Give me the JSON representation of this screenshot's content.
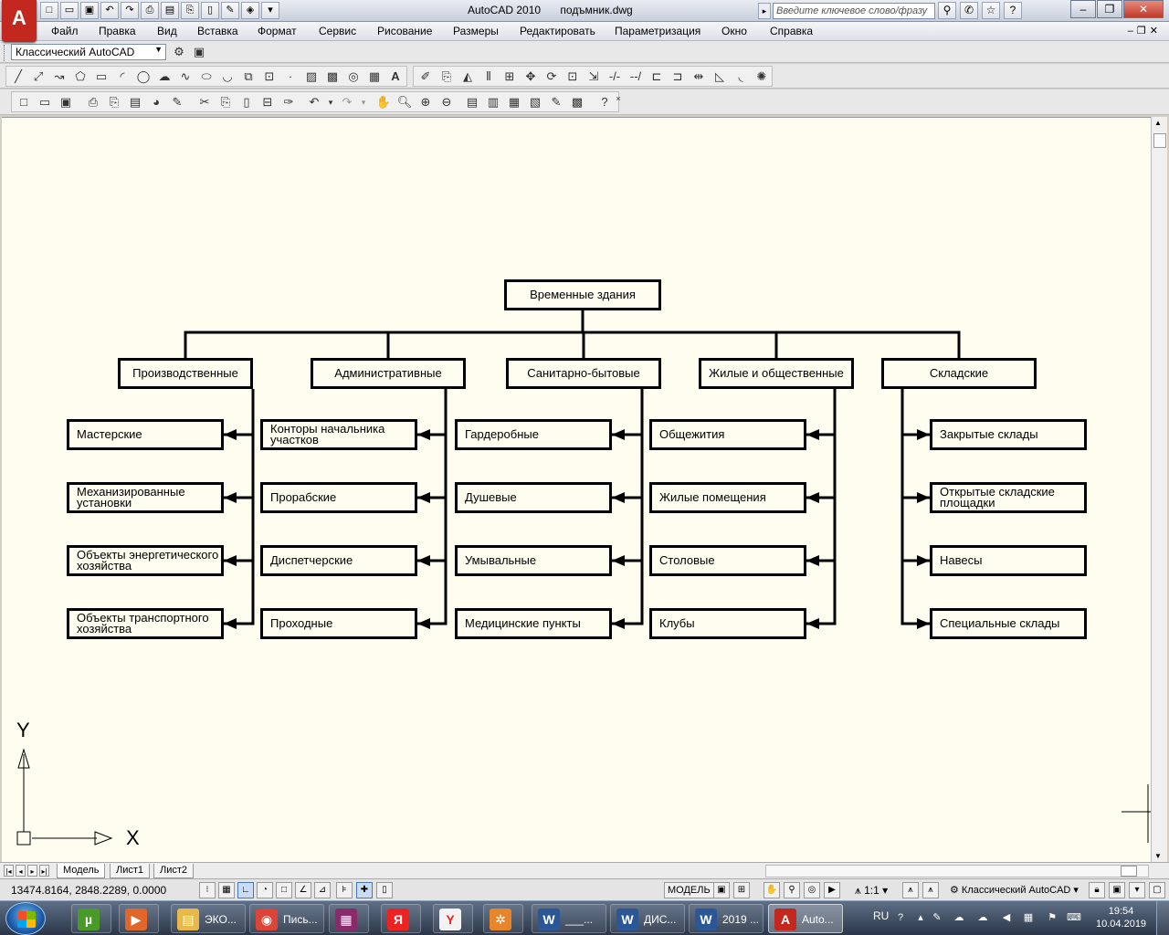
{
  "window": {
    "app_title": "AutoCAD 2010",
    "document": "подъмник.dwg",
    "search_placeholder": "Введите ключевое слово/фразу",
    "logo_letter": "A"
  },
  "menu": [
    "Файл",
    "Правка",
    "Вид",
    "Вставка",
    "Формат",
    "Сервис",
    "Рисование",
    "Размеры",
    "Редактировать",
    "Параметризация",
    "Окно",
    "Справка"
  ],
  "workspace": "Классический AutoCAD",
  "chart": {
    "root": "Временные здания",
    "categories": [
      {
        "label": "Производственные",
        "items": [
          "Мастерские",
          "Механизированные\nустановки",
          "Объекты энергетического\nхозяйства",
          "Объекты транспортного\nхозяйства"
        ]
      },
      {
        "label": "Административные",
        "items": [
          "Конторы начальника\nучастков",
          "Прорабские",
          "Диспетчерские",
          "Проходные"
        ]
      },
      {
        "label": "Санитарно-бытовые",
        "items": [
          "Гардеробные",
          "Душевые",
          "Умывальные",
          "Медицинские пункты"
        ]
      },
      {
        "label": "Жилые и общественные",
        "items": [
          "Общежития",
          "Жилые помещения",
          "Столовые",
          "Клубы"
        ]
      },
      {
        "label": "Складские",
        "items": [
          "Закрытые склады",
          "Открытые складские\nплощадки",
          "Навесы",
          "Специальные склады"
        ]
      }
    ]
  },
  "ucs": {
    "x": "X",
    "y": "Y"
  },
  "layout_tabs": [
    "Модель",
    "Лист1",
    "Лист2"
  ],
  "status": {
    "coords": "13474.8164, 2848.2289, 0.0000",
    "model": "МОДЕЛЬ",
    "scale": "1:1",
    "workspace": "Классический AutoCAD"
  },
  "taskbar": {
    "items": [
      {
        "name": "utorrent",
        "label": "",
        "color": "#4a9a2a",
        "glyph": "µ"
      },
      {
        "name": "media",
        "label": "",
        "color": "#e0662a",
        "glyph": "▶"
      },
      {
        "name": "explorer",
        "label": "ЭКО...",
        "color": "#e8b84a",
        "glyph": "▤"
      },
      {
        "name": "chrome",
        "label": "Пись...",
        "color": "#db4437",
        "glyph": "◉"
      },
      {
        "name": "winrar",
        "label": "",
        "color": "#8a2a6a",
        "glyph": "▦"
      },
      {
        "name": "yandex",
        "label": "",
        "color": "#e22",
        "glyph": "Я"
      },
      {
        "name": "yandex-browser",
        "label": "",
        "color": "#f2f2f2",
        "glyph": "Y"
      },
      {
        "name": "settings",
        "label": "",
        "color": "#e8842a",
        "glyph": "✲"
      },
      {
        "name": "word1",
        "label": "___...",
        "color": "#2b5797",
        "glyph": "W"
      },
      {
        "name": "word2",
        "label": "ДИС...",
        "color": "#2b5797",
        "glyph": "W"
      },
      {
        "name": "word3",
        "label": "2019 ...",
        "color": "#2b5797",
        "glyph": "W"
      },
      {
        "name": "autocad",
        "label": "Auto...",
        "color": "#c2281e",
        "glyph": "A"
      }
    ],
    "lang": "RU",
    "time": "19:54",
    "date": "10.04.2019"
  }
}
